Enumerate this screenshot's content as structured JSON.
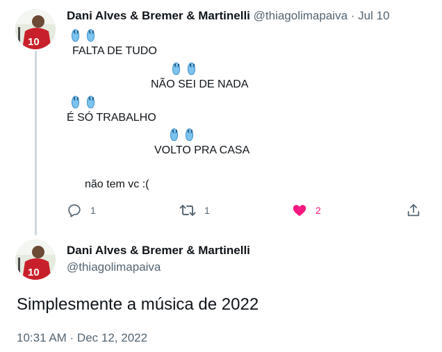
{
  "tweet1": {
    "author_name": "Dani Alves & Bremer & Martinelli",
    "handle": "@thiagolimapaiva",
    "separator": "·",
    "date": "Jul 10",
    "lines": [
      "FALTA DE TUDO",
      "NÃO SEI DE NADA",
      "É SÓ TRABALHO",
      "VOLTO PRA CASA",
      "não tem vc :("
    ],
    "reply_count": "1",
    "retweet_count": "1",
    "like_count": "2"
  },
  "tweet2": {
    "author_name": "Dani Alves & Bremer & Martinelli",
    "handle": "@thiagolimapaiva",
    "text": "Simplesmente a música de 2022",
    "timestamp": "10:31 AM · Dec 12, 2022"
  },
  "colors": {
    "like": "#f91880",
    "muted": "#536471",
    "thread_line": "#cfd9de"
  },
  "icons": [
    "flip-flop-icon",
    "reply-icon",
    "retweet-icon",
    "like-icon",
    "share-icon"
  ]
}
